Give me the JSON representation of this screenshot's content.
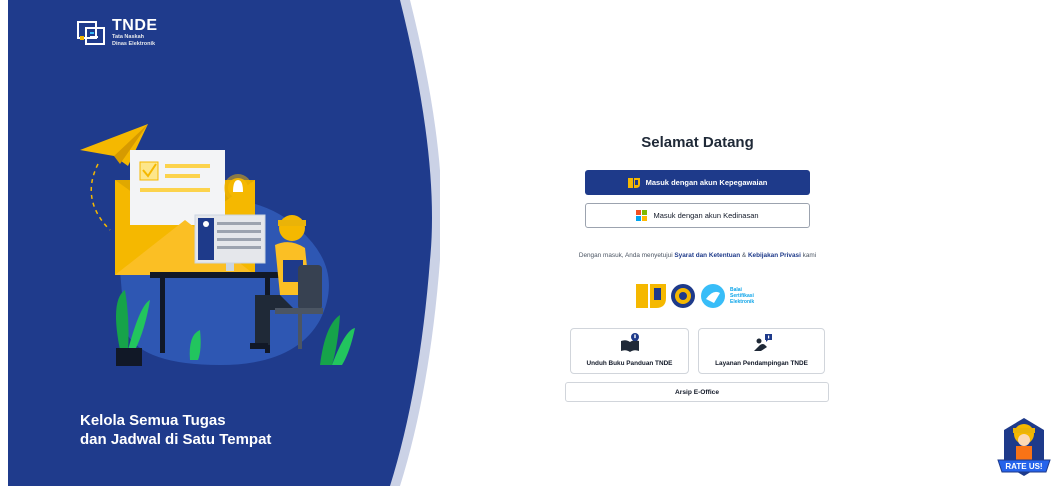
{
  "brand": {
    "title": "TNDE",
    "subtitle_line1": "Tata Naskah",
    "subtitle_line2": "Dinas Elektronik"
  },
  "hero": {
    "tagline_line1": "Kelola Semua Tugas",
    "tagline_line2": "dan Jadwal di Satu Tempat"
  },
  "login": {
    "heading": "Selamat Datang",
    "primary_button": "Masuk dengan akun Kepegawaian",
    "secondary_button": "Masuk dengan akun Kedinasan",
    "terms_prefix": "Dengan masuk, Anda menyetujui",
    "terms_link": "Syarat dan Ketentuan",
    "terms_amp": "&",
    "privacy_link": "Kebijakan Privasi",
    "terms_suffix": "kami"
  },
  "partners": {
    "bse_line1": "Balai",
    "bse_line2": "Sertifikasi",
    "bse_line3": "Elektronik"
  },
  "resources": {
    "guide_label": "Unduh Buku Panduan TNDE",
    "support_label": "Layanan Pendampingan TNDE",
    "archive_label": "Arsip E-Office"
  },
  "rate_us": {
    "label": "RATE US!"
  },
  "colors": {
    "brand_navy": "#1e3a8a",
    "hero_bg": "#1f3b8c",
    "accent_yellow": "#f5b800"
  }
}
